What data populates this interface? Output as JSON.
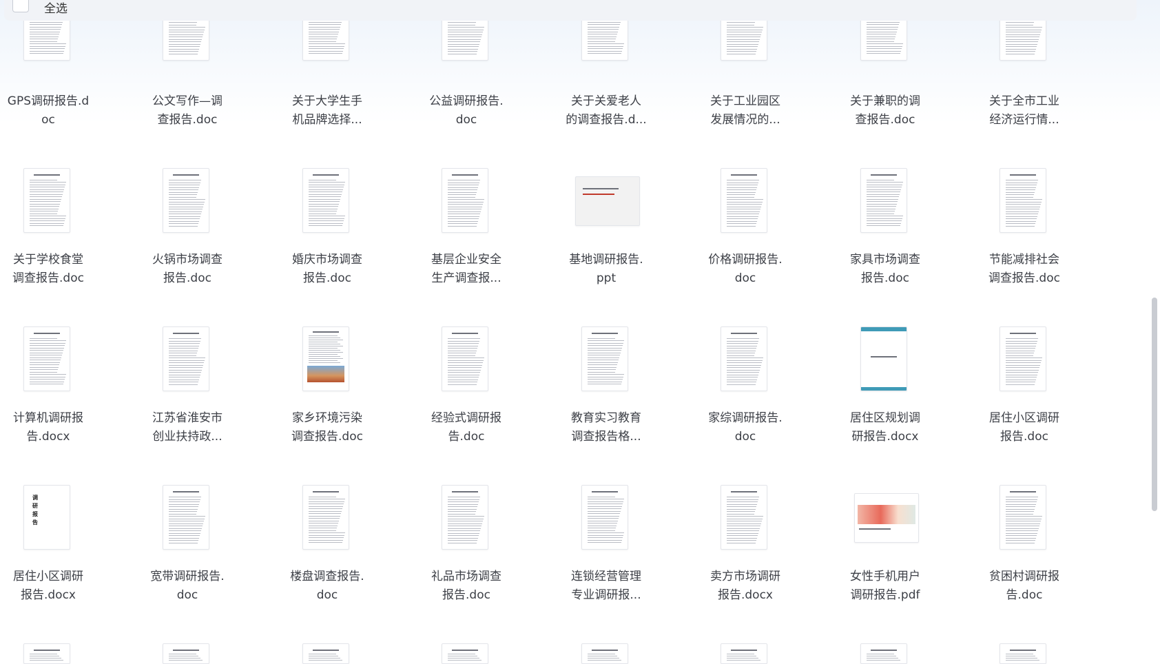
{
  "toolbar": {
    "select_all_label": "全选"
  },
  "files": [
    {
      "name": "GPS调研报告.doc",
      "lines": [
        "GPS调研报告.d",
        "oc"
      ]
    },
    {
      "name": "公文写作—调查报告.doc",
      "lines": [
        "公文写作—调",
        "查报告.doc"
      ]
    },
    {
      "name": "关于大学生手机品牌选择…",
      "lines": [
        "关于大学生手",
        "机品牌选择..."
      ]
    },
    {
      "name": "公益调研报告.doc",
      "lines": [
        "公益调研报告.",
        "doc"
      ]
    },
    {
      "name": "关于关爱老人的调查报告.d…",
      "lines": [
        "关于关爱老人",
        "的调查报告.d..."
      ]
    },
    {
      "name": "关于工业园区发展情况的…",
      "lines": [
        "关于工业园区",
        "发展情况的..."
      ]
    },
    {
      "name": "关于兼职的调查报告.doc",
      "lines": [
        "关于兼职的调",
        "查报告.doc"
      ]
    },
    {
      "name": "关于全市工业经济运行情…",
      "lines": [
        "关于全市工业",
        "经济运行情..."
      ]
    },
    {
      "name": "关于学校食堂调查报告.doc",
      "lines": [
        "关于学校食堂",
        "调查报告.doc"
      ]
    },
    {
      "name": "火锅市场调查报告.doc",
      "lines": [
        "火锅市场调查",
        "报告.doc"
      ]
    },
    {
      "name": "婚庆市场调查报告.doc",
      "lines": [
        "婚庆市场调查",
        "报告.doc"
      ]
    },
    {
      "name": "基层企业安全生产调查报…",
      "lines": [
        "基层企业安全",
        "生产调查报..."
      ]
    },
    {
      "name": "基地调研报告.ppt",
      "lines": [
        "基地调研报告.",
        "ppt"
      ]
    },
    {
      "name": "价格调研报告.doc",
      "lines": [
        "价格调研报告.",
        "doc"
      ]
    },
    {
      "name": "家具市场调查报告.doc",
      "lines": [
        "家具市场调查",
        "报告.doc"
      ]
    },
    {
      "name": "节能减排社会调查报告.doc",
      "lines": [
        "节能减排社会",
        "调查报告.doc"
      ]
    },
    {
      "name": "计算机调研报告.docx",
      "lines": [
        "计算机调研报",
        "告.docx"
      ]
    },
    {
      "name": "江苏省淮安市创业扶持政…",
      "lines": [
        "江苏省淮安市",
        "创业扶持政..."
      ]
    },
    {
      "name": "家乡环境污染调查报告.doc",
      "lines": [
        "家乡环境污染",
        "调查报告.doc"
      ]
    },
    {
      "name": "经验式调研报告.doc",
      "lines": [
        "经验式调研报",
        "告.doc"
      ]
    },
    {
      "name": "教育实习教育调查报告格…",
      "lines": [
        "教育实习教育",
        "调查报告格..."
      ]
    },
    {
      "name": "家综调研报告.doc",
      "lines": [
        "家综调研报告.",
        "doc"
      ]
    },
    {
      "name": "居住区规划调研报告.docx",
      "lines": [
        "居住区规划调",
        "研报告.docx"
      ]
    },
    {
      "name": "居住小区调研报告.doc",
      "lines": [
        "居住小区调研",
        "报告.doc"
      ]
    },
    {
      "name": "居住小区调研报告.docx",
      "lines": [
        "居住小区调研",
        "报告.docx"
      ]
    },
    {
      "name": "宽带调研报告.doc",
      "lines": [
        "宽带调研报告.",
        "doc"
      ]
    },
    {
      "name": "楼盘调查报告.doc",
      "lines": [
        "楼盘调查报告.",
        "doc"
      ]
    },
    {
      "name": "礼品市场调查报告.doc",
      "lines": [
        "礼品市场调查",
        "报告.doc"
      ]
    },
    {
      "name": "连锁经营管理专业调研报…",
      "lines": [
        "连锁经营管理",
        "专业调研报..."
      ]
    },
    {
      "name": "卖方市场调研报告.docx",
      "lines": [
        "卖方市场调研",
        "报告.docx"
      ]
    },
    {
      "name": "女性手机用户调研报告.pdf",
      "lines": [
        "女性手机用户",
        "调研报告.pdf"
      ]
    },
    {
      "name": "贫困村调研报告.doc",
      "lines": [
        "贫困村调研报",
        "告.doc"
      ]
    }
  ],
  "thumb_kinds": [
    "doc",
    "doc",
    "doc",
    "doc",
    "doc",
    "doc",
    "doc",
    "doc",
    "doc",
    "doc",
    "doc",
    "doc",
    "ppt",
    "doc",
    "doc",
    "doc",
    "doc",
    "doc",
    "photo-doc",
    "doc",
    "doc",
    "doc",
    "teal",
    "doc",
    "vertical",
    "doc",
    "doc",
    "doc",
    "doc",
    "doc",
    "pdf-photo",
    "doc"
  ],
  "thumb_vertical_text": "调研报告"
}
